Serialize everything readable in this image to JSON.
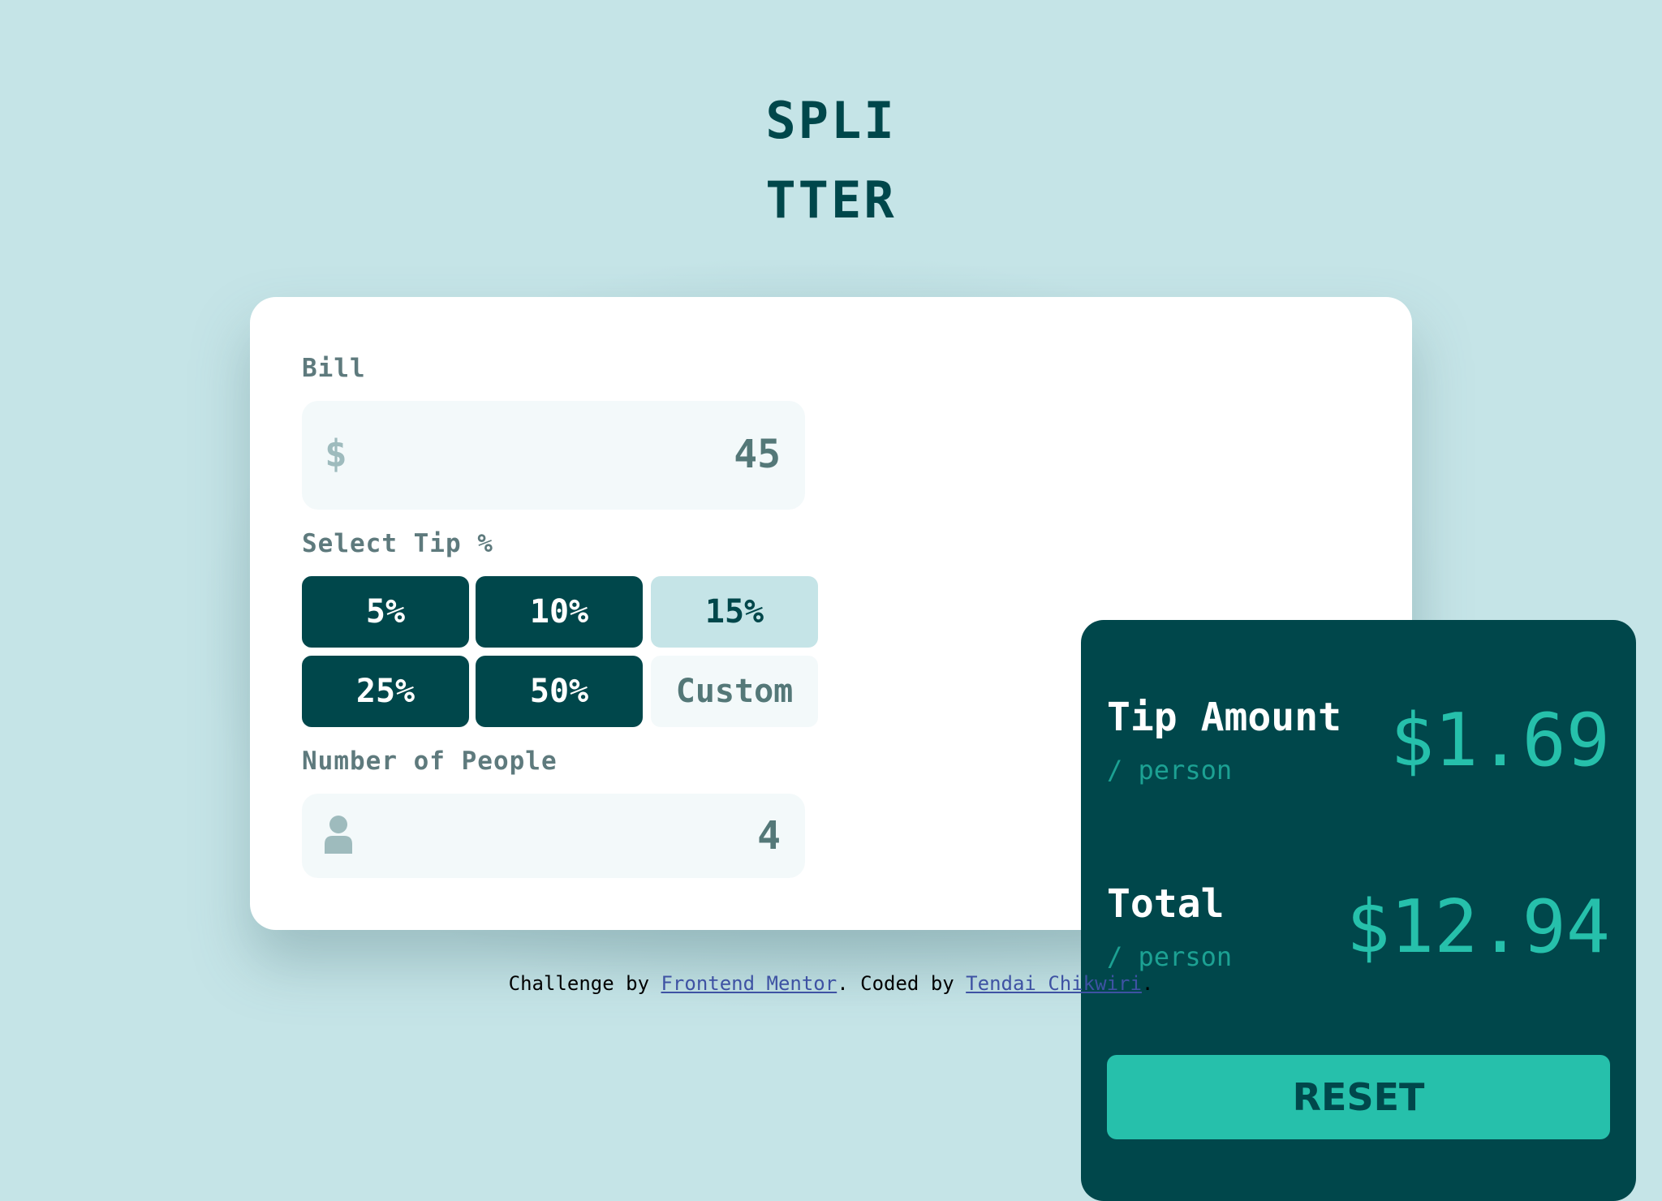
{
  "app": {
    "logo_line1": "SPLI",
    "logo_line2": "TTER"
  },
  "bill": {
    "label": "Bill",
    "currency_icon": "$",
    "value": "45"
  },
  "tip": {
    "label": "Select Tip %",
    "options": [
      {
        "label": "5%",
        "selected": false
      },
      {
        "label": "10%",
        "selected": false
      },
      {
        "label": "15%",
        "selected": true
      },
      {
        "label": "25%",
        "selected": false
      },
      {
        "label": "50%",
        "selected": false
      }
    ],
    "custom_placeholder": "Custom"
  },
  "people": {
    "label": "Number of People",
    "icon": "person-icon",
    "value": "4"
  },
  "results": {
    "tip_title": "Tip Amount",
    "tip_sub": "/ person",
    "tip_value": "$1.69",
    "total_title": "Total",
    "total_sub": "/ person",
    "total_value": "$12.94",
    "reset_label": "RESET"
  },
  "footer": {
    "prefix": "Challenge by ",
    "link1": "Frontend Mentor",
    "middle": ". Coded by ",
    "link2": "Tendai Chikwiri",
    "suffix": "."
  },
  "colors": {
    "background": "#c5e4e7",
    "dark_teal": "#00474b",
    "accent": "#26c0ab",
    "field_bg": "#f3f9fa"
  }
}
